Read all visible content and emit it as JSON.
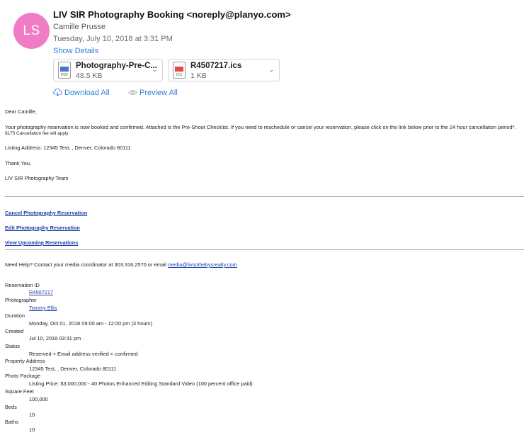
{
  "header": {
    "avatar_initials": "LS",
    "from": "LIV SIR Photography Booking <noreply@planyo.com>",
    "to": "Camille Prusse",
    "date": "Tuesday, July 10, 2018 at 3:31 PM",
    "show_details": "Show Details"
  },
  "attachments": [
    {
      "name": "Photography-Pre-C...",
      "size": "48.5 KB",
      "ext": "PDF",
      "icon": "pdf-file-icon",
      "color": "#4a78c8"
    },
    {
      "name": "R4507217.ics",
      "size": "1 KB",
      "ext": "ICS",
      "icon": "calendar-file-icon",
      "color": "#e04a4a"
    }
  ],
  "actions": {
    "download_all": "Download All",
    "preview_all": "Preview All"
  },
  "body": {
    "greeting": "Dear Camille,",
    "para1": "Your photography reservation is now booked and confirmed. Attached is the Pre-Shoot Checklist. If you need to reschedule or cancel your reservation, please click on the link below prior to the 24 hour cancellation period*.",
    "fee": "$175 Cancellation fee will apply",
    "listing": "Listing Address: 12345 Test, , Denver, Colorado 80111",
    "thanks": "Thank You,",
    "team": "LIV SIR Photography Team",
    "links": {
      "cancel": "Cancel Photography Reservation",
      "edit": "Edit Photography Reservation",
      "view": "View Upcoming Reservations"
    },
    "help_prefix": "Need Help? Contact your media coordinator at 303.316.2570 or email ",
    "help_email": "media@livsothebysrealty.com"
  },
  "reservation": {
    "id_label": "Reservation ID",
    "id_value": "R4507217",
    "photographer_label": "Photographer",
    "photographer_value": "Tommy Ellis",
    "duration_label": "Duration",
    "duration_value": "Monday, Oct 01, 2018 09:00 am - 12:00 pm (3 hours)",
    "created_label": "Created",
    "created_value": "Jul 10, 2018 03:31 pm",
    "status_label": "Status",
    "status_value": "Reserved + Email address verified + confirmed",
    "property_label": "Property Address",
    "property_value": "12345 Test, , Denver, Colorado 80111",
    "package_label": "Photo Package",
    "package_value": "Listing Price: $3,000,000 - 40 Photos Enhanced Editing Standard Video (100 percent office paid)",
    "sqft_label": "Square Feet",
    "sqft_value": "100,000",
    "beds_label": "Beds",
    "beds_value": "10",
    "baths_label": "Baths",
    "baths_value": "10"
  }
}
